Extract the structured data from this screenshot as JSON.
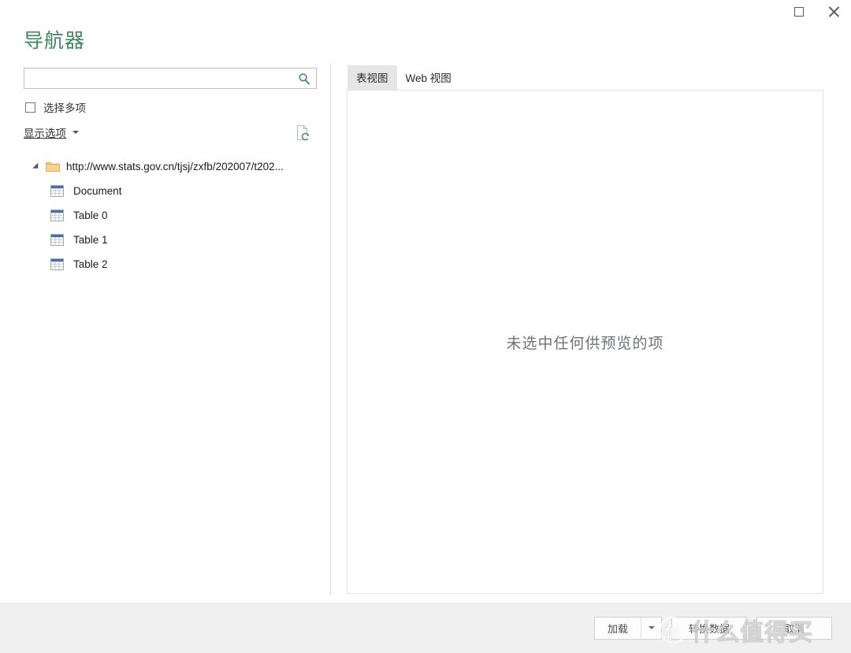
{
  "window": {
    "maximize_label": "Maximize",
    "close_label": "Close"
  },
  "page_title": "导航器",
  "search": {
    "value": "",
    "placeholder": "",
    "icon": "search-icon"
  },
  "select_multiple": {
    "label": "选择多项",
    "checked": false
  },
  "display_options": {
    "label": "显示选项",
    "caret": "▾",
    "refresh_icon": "refresh-document-icon"
  },
  "tree": {
    "root": {
      "label": "http://www.stats.gov.cn/tjsj/zxfb/202007/t202...",
      "icon": "folder-icon",
      "expanded": true
    },
    "children": [
      {
        "label": "Document",
        "icon": "table-icon"
      },
      {
        "label": "Table 0",
        "icon": "table-icon"
      },
      {
        "label": "Table 1",
        "icon": "table-icon"
      },
      {
        "label": "Table 2",
        "icon": "table-icon"
      }
    ]
  },
  "preview": {
    "tabs": [
      {
        "label": "表视图",
        "active": true
      },
      {
        "label": "Web 视图",
        "active": false
      }
    ],
    "empty_message": "未选中任何供预览的项"
  },
  "footer": {
    "load_button": "加载",
    "load_dropdown": "▾",
    "transform_button": "转换数据",
    "cancel_button": "取消"
  },
  "watermark": {
    "badge": "值",
    "text": "什么值得买"
  },
  "colors": {
    "title_green": "#3e8662",
    "accent_blue": "#4472a8",
    "folder_yellow": "#f2c26b",
    "footer_bg": "#f0f0f0",
    "tab_active_bg": "#e6e6e6",
    "preview_text": "#6e7278"
  }
}
